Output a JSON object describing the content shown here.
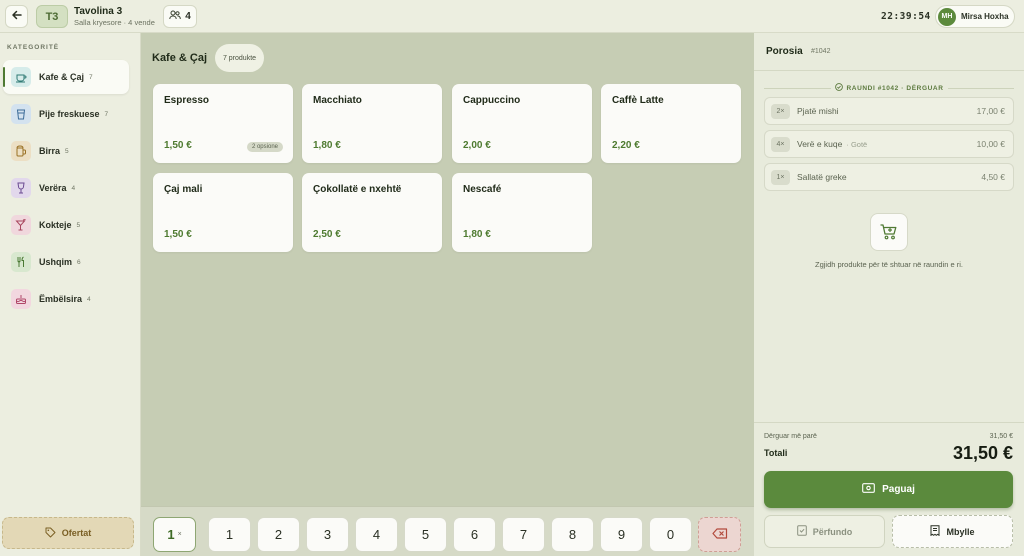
{
  "header": {
    "table_badge": "T3",
    "table_name": "Tavolina 3",
    "table_sub": "Salla kryesore · 4 vende",
    "guests": "4",
    "clock": "22:39:54",
    "user_initials": "MH",
    "user_name": "Mirsa Hoxha"
  },
  "sidebar": {
    "title": "KATEGORITË",
    "items": [
      {
        "label": "Kafe & Çaj",
        "count": "7",
        "icon": "coffee-icon",
        "color": "#d6ecea"
      },
      {
        "label": "Pije freskuese",
        "count": "7",
        "icon": "cup-icon",
        "color": "#d3e2ef"
      },
      {
        "label": "Birra",
        "count": "5",
        "icon": "beer-icon",
        "color": "#ecdfc4"
      },
      {
        "label": "Verëra",
        "count": "4",
        "icon": "wine-icon",
        "color": "#e2d8ec"
      },
      {
        "label": "Kokteje",
        "count": "5",
        "icon": "cocktail-icon",
        "color": "#f0d7dd"
      },
      {
        "label": "Ushqim",
        "count": "6",
        "icon": "utensils-icon",
        "color": "#d8e8cf"
      },
      {
        "label": "Ëmbëlsira",
        "count": "4",
        "icon": "cake-icon",
        "color": "#f2d7df"
      }
    ],
    "offers": "Ofertat"
  },
  "main": {
    "title": "Kafe & Çaj",
    "count": "7 produkte",
    "products": [
      {
        "name": "Espresso",
        "price": "1,50 €",
        "option": "2 opsione"
      },
      {
        "name": "Macchiato",
        "price": "1,80 €"
      },
      {
        "name": "Cappuccino",
        "price": "2,00 €"
      },
      {
        "name": "Caffè Latte",
        "price": "2,20 €"
      },
      {
        "name": "Çaj mali",
        "price": "1,50 €"
      },
      {
        "name": "Çokollatë e nxehtë",
        "price": "2,50 €"
      },
      {
        "name": "Nescafé",
        "price": "1,80 €"
      }
    ]
  },
  "keypad": {
    "multiplier": "1",
    "multiplier_suffix": "×",
    "keys": [
      "1",
      "2",
      "3",
      "4",
      "5",
      "6",
      "7",
      "8",
      "9",
      "0"
    ]
  },
  "order": {
    "title": "Porosia",
    "id": "#1042",
    "round": "RAUNDI #1042 · DËRGUAR",
    "items": [
      {
        "qty": "2×",
        "name": "Pjatë mishi",
        "note": "",
        "price": "17,00 €"
      },
      {
        "qty": "4×",
        "name": "Verë e kuqe",
        "note": "· Gotë",
        "price": "10,00 €"
      },
      {
        "qty": "1×",
        "name": "Sallatë greke",
        "note": "",
        "price": "4,50 €"
      }
    ],
    "empty_text": "Zgjidh produkte për të shtuar në raundin e ri.",
    "sent_label": "Dërguar më parë",
    "sent_value": "31,50 €",
    "total_label": "Totali",
    "total_value": "31,50 €",
    "pay": "Paguaj",
    "finish": "Përfundo",
    "close": "Mbylle"
  }
}
